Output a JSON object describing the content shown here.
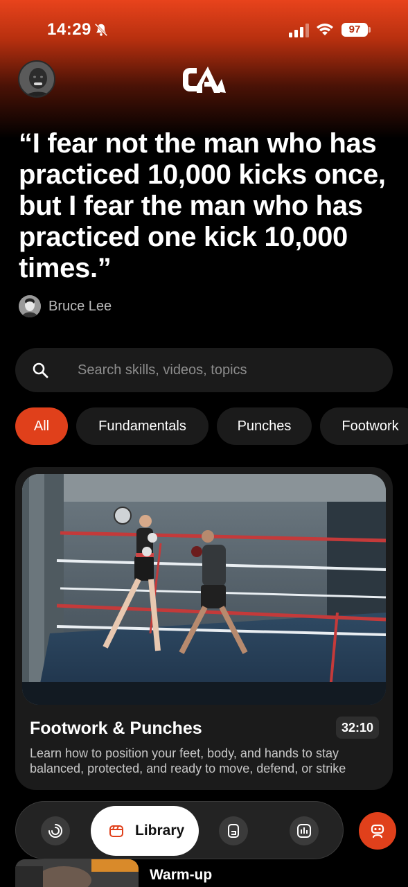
{
  "status_bar": {
    "time": "14:29",
    "battery": "97"
  },
  "header": {
    "logo_text": "CA"
  },
  "quote": {
    "text": "“I fear not the man who has practiced 10,000 kicks once, but I fear the man who has practiced one kick 10,000 times.”",
    "author": "Bruce Lee"
  },
  "search": {
    "placeholder": "Search skills, videos, topics",
    "value": ""
  },
  "chips": [
    {
      "label": "All",
      "active": true
    },
    {
      "label": "Fundamentals",
      "active": false
    },
    {
      "label": "Punches",
      "active": false
    },
    {
      "label": "Footwork",
      "active": false
    }
  ],
  "video_card": {
    "title": "Footwork & Punches",
    "duration": "32:10",
    "description": "Learn how to position your feet, body, and hands to stay balanced, protected, and ready to move, defend, or strike"
  },
  "next_card": {
    "title": "Warm-up"
  },
  "tab_bar": {
    "tabs": [
      {
        "icon": "progress-icon"
      },
      {
        "label": "Library",
        "icon": "library-icon",
        "active": true
      },
      {
        "icon": "drills-icon"
      },
      {
        "icon": "stats-icon"
      }
    ],
    "assistant_icon": "robot-icon"
  },
  "colors": {
    "accent": "#e0401b",
    "card_bg": "#1b1b1b",
    "background": "#000000"
  }
}
